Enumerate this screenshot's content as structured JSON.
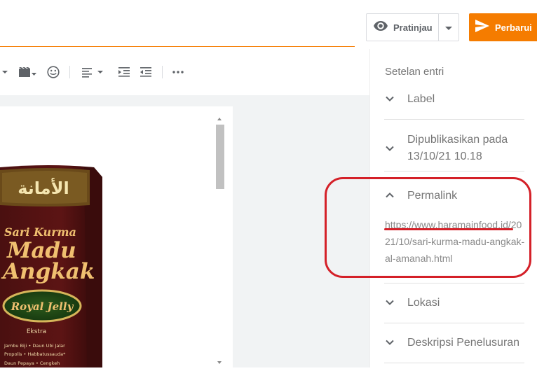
{
  "header": {
    "preview_label": "Pratinjau",
    "update_label": "Perbarui",
    "accent_color": "#f57c00"
  },
  "toolbar": {
    "icons": [
      "dropdown-caret-icon",
      "video-icon",
      "emoji-icon",
      "align-left-icon",
      "indent-icon",
      "outdent-icon",
      "more-icon"
    ]
  },
  "sidebar": {
    "heading": "Setelan entri",
    "label_section": "Label",
    "published_section": "Dipublikasikan pada 13/10/21 10.18",
    "permalink_section": "Permalink",
    "permalink_url": "https://www.haramainfood.id/2021/10/sari-kurma-madu-angkak-al-amanah.html",
    "location_section": "Lokasi",
    "search_desc_section": "Deskripsi Penelusuran"
  },
  "product": {
    "arabic_brand": "الأمانة",
    "line1": "Sari Kurma",
    "line2": "Madu",
    "line3": "Angkak",
    "badge": "Royal Jelly",
    "extra_title": "Ekstra",
    "extra_text": "Jambu Biji • Daun Ubi Jalar Propolis • Habbatussauda"
  },
  "annotation": {
    "highlight_color": "#d42028"
  }
}
